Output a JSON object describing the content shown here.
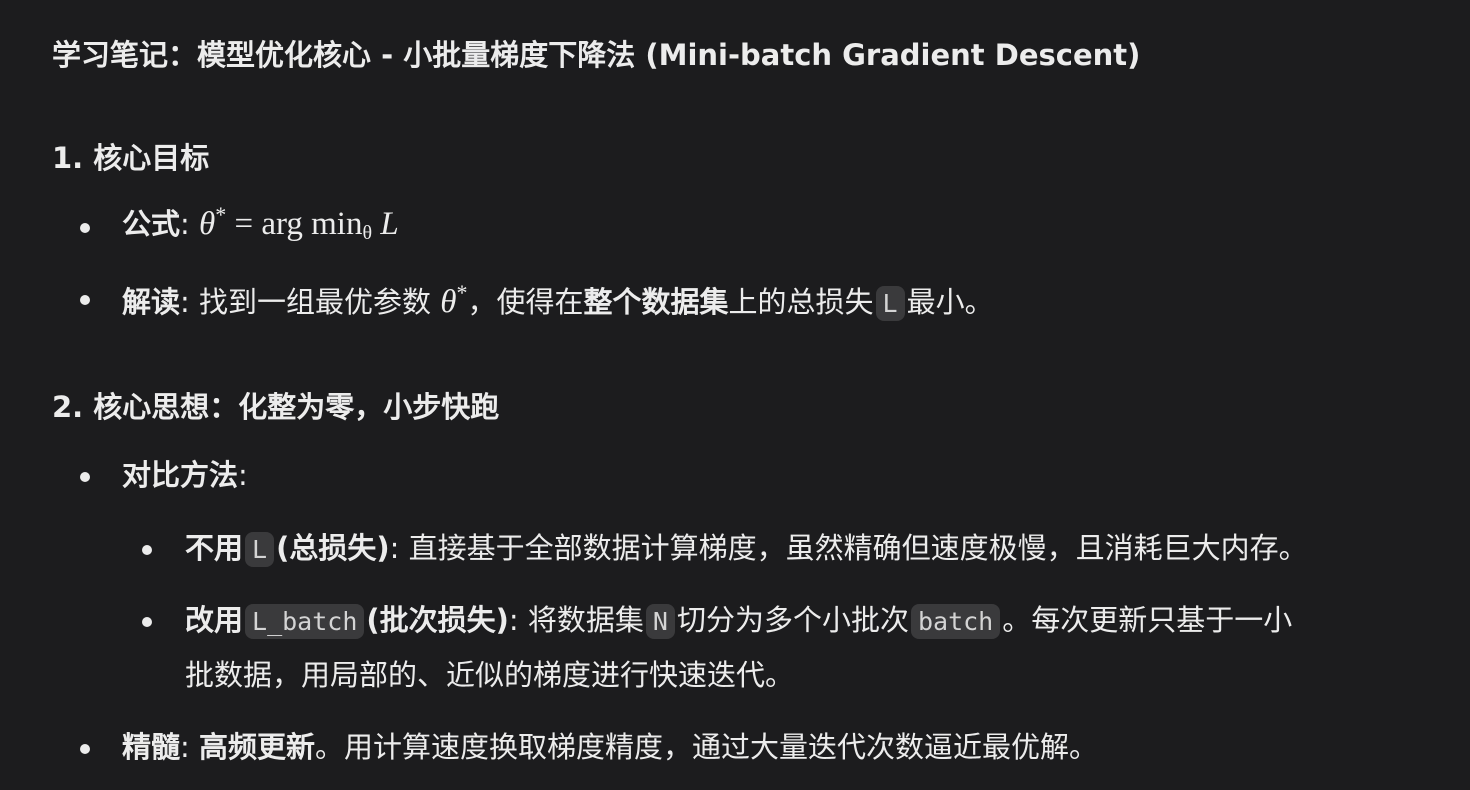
{
  "title": "学习笔记：模型优化核心 - 小批量梯度下降法 (Mini-batch Gradient Descent)",
  "section1": {
    "heading": "1. 核心目标",
    "formula": {
      "label": "公式",
      "colon": ": ",
      "theta": "θ",
      "star": "*",
      "equals": " = arg min",
      "sub": "θ",
      "L": "L"
    },
    "interpretation": {
      "label": "解读",
      "text1": ": 找到一组最优参数 ",
      "theta": "θ",
      "star": "*",
      "text2": "，使得在",
      "bold": "整个数据集",
      "text3": "上的总损失",
      "code": "L",
      "text4": "最小。"
    }
  },
  "section2": {
    "heading": "2. 核心思想：化整为零，小步快跑",
    "compare_label": "对比方法",
    "compare_colon": ":",
    "no_use": {
      "bold1": "不用",
      "code": "L",
      "bold2": "(总损失)",
      "text": ": 直接基于全部数据计算梯度，虽然精确但速度极慢，且消耗巨大内存。"
    },
    "use": {
      "bold1": "改用",
      "code": "L_batch",
      "bold2": "(批次损失)",
      "text1": ": 将数据集",
      "code2": "N",
      "text2": "切分为多个小批次",
      "code3": "batch",
      "text3": "。每次更新只基于一小",
      "text4": "批数据，用局部的、近似的梯度进行快速迭代。"
    },
    "essence": {
      "label": "精髓",
      "colon": ": ",
      "bold": "高频更新",
      "text": "。用计算速度换取梯度精度，通过大量迭代次数逼近最优解。"
    }
  }
}
